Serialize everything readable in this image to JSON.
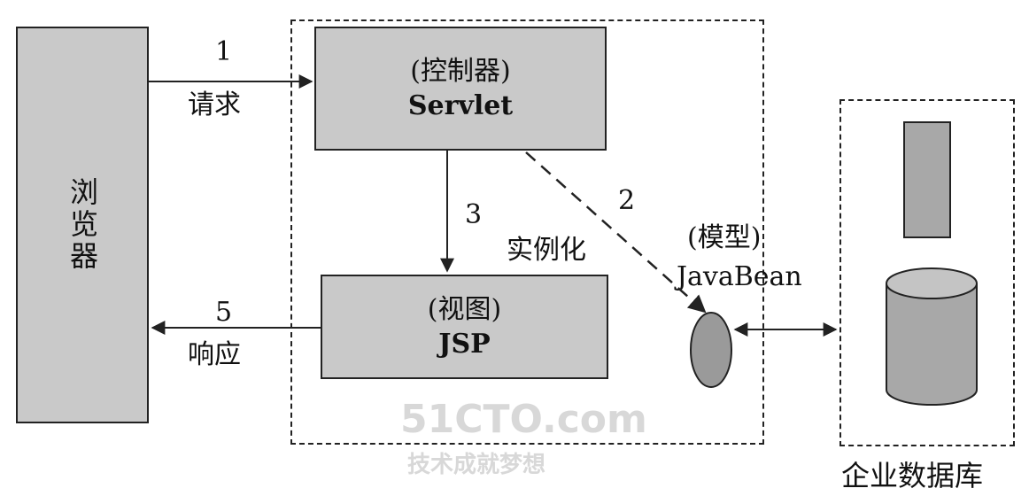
{
  "browser": {
    "label": "浏览器"
  },
  "controller": {
    "role": "(控制器)",
    "name": "Servlet"
  },
  "view": {
    "role": "(视图)",
    "name": "JSP"
  },
  "model": {
    "role": "(模型)",
    "name": "JavaBean"
  },
  "database": {
    "label": "企业数据库"
  },
  "arrows": {
    "request": {
      "number": "1",
      "label": "请求"
    },
    "model_call": {
      "number": "2"
    },
    "instantiate": {
      "number": "3",
      "label": "实例化"
    },
    "response": {
      "number": "5",
      "label": "响应"
    }
  },
  "watermark": {
    "line1": "51CTO.com",
    "line2": "技术成就梦想"
  }
}
